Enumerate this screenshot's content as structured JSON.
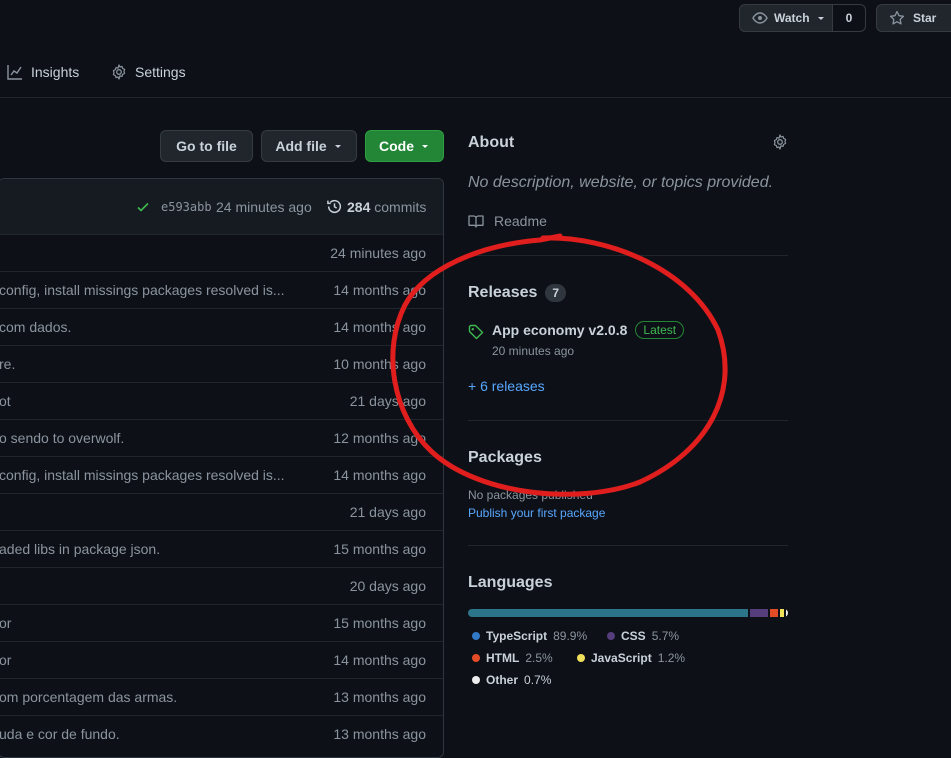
{
  "header": {
    "watch_label": "Watch",
    "watch_count": "0",
    "star_label": "Star"
  },
  "tabs": {
    "insights": "Insights",
    "settings": "Settings"
  },
  "toolbar": {
    "go_to_file": "Go to file",
    "add_file": "Add file",
    "code": "Code"
  },
  "commit_bar": {
    "hash": "e593abb",
    "time": "24 minutes ago",
    "commit_count": "284",
    "commits_label": "commits"
  },
  "files": [
    {
      "message": "",
      "age": "24 minutes ago"
    },
    {
      "message": "config, install missings packages resolved is...",
      "age": "14 months ago"
    },
    {
      "message": "com dados.",
      "age": "14 months ago"
    },
    {
      "message": "re.",
      "age": "10 months ago"
    },
    {
      "message": "ot",
      "age": "21 days ago"
    },
    {
      "message": "o sendo to overwolf.",
      "age": "12 months ago"
    },
    {
      "message": "config, install missings packages resolved is...",
      "age": "14 months ago"
    },
    {
      "message": "",
      "age": "21 days ago"
    },
    {
      "message": "aded libs in package json.",
      "age": "15 months ago"
    },
    {
      "message": "",
      "age": "20 days ago"
    },
    {
      "message": "or",
      "age": "15 months ago"
    },
    {
      "message": "or",
      "age": "14 months ago"
    },
    {
      "message": "om porcentagem das armas.",
      "age": "13 months ago"
    },
    {
      "message": "uda e cor de fundo.",
      "age": "13 months ago"
    }
  ],
  "about": {
    "title": "About",
    "description": "No description, website, or topics provided.",
    "readme": "Readme"
  },
  "releases": {
    "title": "Releases",
    "count": "7",
    "latest_name": "App economy v2.0.8",
    "latest_badge": "Latest",
    "latest_time": "20 minutes ago",
    "more_link": "+ 6 releases"
  },
  "packages": {
    "title": "Packages",
    "none_text": "No packages published",
    "publish_link": "Publish your first package"
  },
  "languages": {
    "title": "Languages",
    "items": [
      {
        "name": "TypeScript",
        "percent": "89.9%",
        "value": 89.9,
        "color": "#3178c6"
      },
      {
        "name": "CSS",
        "percent": "5.7%",
        "value": 5.7,
        "color": "#563d7c"
      },
      {
        "name": "HTML",
        "percent": "2.5%",
        "value": 2.5,
        "color": "#e34c26"
      },
      {
        "name": "JavaScript",
        "percent": "1.2%",
        "value": 1.2,
        "color": "#f1e05a"
      },
      {
        "name": "Other",
        "percent": "0.7%",
        "value": 0.7,
        "color": "#ededed"
      }
    ]
  },
  "colors": {
    "background": "#0d1117",
    "accent_green": "#238636",
    "link_blue": "#58a6ff",
    "annotation_red": "#e01e1e",
    "ts_bar": "#2b7489"
  }
}
